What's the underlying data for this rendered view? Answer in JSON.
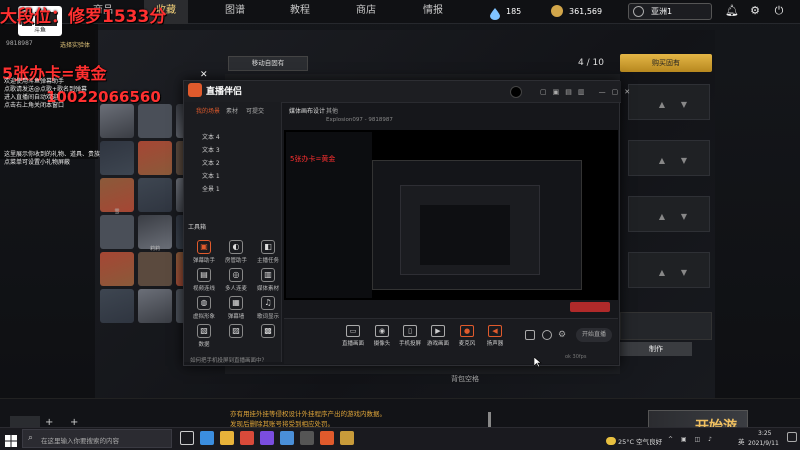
{
  "game": {
    "nav_tabs": [
      "商品",
      "收藏",
      "图谱",
      "教程",
      "商店",
      "情报"
    ],
    "currency_blue": "185",
    "currency_gold": "361,569",
    "region": "亚洲1",
    "page_indicator": "4 / 10",
    "search_button": "购买固有",
    "filter_button": "移动自固有",
    "make_button": "制作",
    "backpack_label": "背包空格",
    "start_button": "开始游戏",
    "notice_line1": "亦有用挂外挂等侵权设计外挂程序产出的游戏内数据。",
    "notice_line2": "发现后删除其账号将受到相应处罚。"
  },
  "overlay": {
    "rank_text": "大段位：修罗1533分",
    "card_text": "5张办卡=黄金",
    "phone_text": "10022066560",
    "hero_id": "9818987",
    "hero_tag": "选择实验体",
    "notes_a": [
      "欢迎使用斗鱼弹幕助手",
      "点歌请发送@点歌+歌名到弹幕",
      "进入直播间自动欢迎",
      "点击右上角关闭本窗口"
    ],
    "notes_b": [
      "这里展示你收到的礼物、道具、贵族开通",
      "点菜单可设置小礼物屏蔽"
    ]
  },
  "characters": {
    "labels": [
      "",
      "",
      "",
      "",
      "",
      "",
      "",
      "",
      "杰基",
      "",
      "",
      "",
      "雪",
      "",
      "",
      "",
      "莉莉",
      "芙",
      "",
      "",
      "黛博拉",
      "",
      "",
      "",
      "",
      "",
      "",
      "",
      "阿德里安",
      "",
      "雪",
      ""
    ]
  },
  "streamer": {
    "app_title": "直播伴侣",
    "tabs": [
      "我的场景",
      "素材",
      "可提交"
    ],
    "sources": [
      "文本 4",
      "文本 3",
      "文本 2",
      "文本 1",
      "全景 1"
    ],
    "top_tabs": [
      "媒体画布设计",
      "其他"
    ],
    "tool_title": "工具箱",
    "tools": [
      "弹幕助手",
      "房管助手",
      "主播任务",
      "视频连线",
      "多人连麦",
      "媒体素材",
      "虚拟形象",
      "弹幕墙",
      "歌词显示",
      "数据",
      "",
      "",
      ""
    ],
    "bottom_buttons": [
      "直播画面",
      "摄像头",
      "手机投屏",
      "游戏画面",
      "麦克风",
      "扬声器"
    ],
    "status_text": "ok 30fps",
    "start_live": "开始直播",
    "hint_text": "如何把手机投屏到直播画面中？",
    "user_tag": "Explosion097 - 9818987"
  },
  "taskbar": {
    "search_placeholder": "在这里输入你要搜索的内容",
    "weather": "25°C 空气良好",
    "lang": "英",
    "time": "3:25",
    "date": "2021/9/11"
  }
}
